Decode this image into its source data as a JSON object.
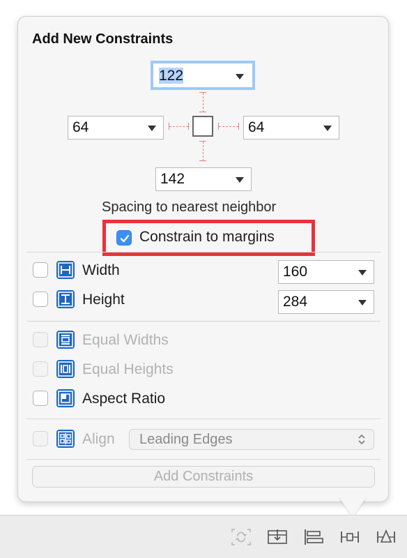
{
  "popover": {
    "title": "Add New Constraints",
    "spacing": {
      "top": "122",
      "left": "64",
      "right": "64",
      "bottom": "142",
      "label": "Spacing to nearest neighbor"
    },
    "constrain_to_margins": {
      "label": "Constrain to margins",
      "checked": true
    },
    "size": [
      {
        "label": "Width",
        "value": "160",
        "checked": false,
        "icon": "width-constraint-icon"
      },
      {
        "label": "Height",
        "value": "284",
        "checked": false,
        "icon": "height-constraint-icon"
      }
    ],
    "equal": [
      {
        "label": "Equal Widths",
        "enabled": false,
        "icon": "equal-widths-icon"
      },
      {
        "label": "Equal Heights",
        "enabled": false,
        "icon": "equal-heights-icon"
      },
      {
        "label": "Aspect Ratio",
        "enabled": true,
        "icon": "aspect-ratio-icon"
      }
    ],
    "align": {
      "label": "Align",
      "value": "Leading Edges",
      "enabled": false,
      "icon": "align-icon"
    },
    "add_button": "Add Constraints"
  },
  "toolbar": {
    "icons": [
      "update-frames-icon",
      "embed-in-stack-icon",
      "align-icon",
      "add-constraints-icon",
      "resolve-layout-icon"
    ]
  },
  "colors": {
    "accent": "#3b8ff2",
    "highlight": "#e8333a",
    "focus_ring": "#9ec9f6",
    "constraint_line": "#e77f7f"
  }
}
